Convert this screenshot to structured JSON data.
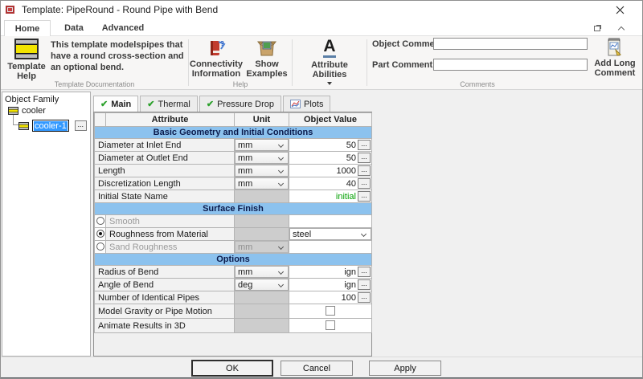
{
  "window": {
    "title": "Template: PipeRound - Round Pipe with Bend"
  },
  "ribbon_tabs": [
    {
      "label": "Home"
    },
    {
      "label": "Data"
    },
    {
      "label": "Advanced"
    }
  ],
  "groups": {
    "template_documentation": {
      "template_help_label": "Template Help",
      "description": "This template modelspipes that have a round cross-section and an optional bend.",
      "group_label": "Template Documentation"
    },
    "help": {
      "connectivity_label": "Connectivity Information",
      "show_examples_label": "Show Examples",
      "group_label": "Help"
    },
    "attribute_abilities": {
      "label": "Attribute Abilities",
      "icon_letter": "A"
    },
    "comments": {
      "object_comment_label": "Object Comment:",
      "object_comment_value": "",
      "part_comment_label": "Part Comment:",
      "part_comment_value": "",
      "add_long_comment_label": "Add Long Comment",
      "group_label": "Comments"
    }
  },
  "object_family": {
    "title": "Object Family",
    "root_item": "cooler",
    "child_item": "cooler-1",
    "ellipsis_label": "..."
  },
  "editor": {
    "tabs": [
      {
        "label": "Main",
        "icon": "check",
        "active": true
      },
      {
        "label": "Thermal",
        "icon": "check",
        "active": false
      },
      {
        "label": "Pressure Drop",
        "icon": "check",
        "active": false
      },
      {
        "label": "Plots",
        "icon": "chart",
        "active": false
      }
    ],
    "columns": [
      "Attribute",
      "Unit",
      "Object Value"
    ],
    "ellipsis_label": "...",
    "rows": [
      {
        "type": "section",
        "label": "Basic Geometry and Initial Conditions"
      },
      {
        "type": "data",
        "attribute": "Diameter at Inlet End",
        "unit": {
          "kind": "combo",
          "value": "mm"
        },
        "value": {
          "kind": "text",
          "text": "50",
          "ellipsis": true
        }
      },
      {
        "type": "data",
        "attribute": "Diameter at Outlet End",
        "unit": {
          "kind": "combo",
          "value": "mm"
        },
        "value": {
          "kind": "text",
          "text": "50",
          "ellipsis": true
        }
      },
      {
        "type": "data",
        "attribute": "Length",
        "unit": {
          "kind": "combo",
          "value": "mm"
        },
        "value": {
          "kind": "text",
          "text": "1000",
          "ellipsis": true
        }
      },
      {
        "type": "data",
        "attribute": "Discretization Length",
        "unit": {
          "kind": "combo",
          "value": "mm"
        },
        "value": {
          "kind": "text",
          "text": "40",
          "ellipsis": true
        }
      },
      {
        "type": "data",
        "attribute": "Initial State Name",
        "unit": {
          "kind": "blank"
        },
        "value": {
          "kind": "text",
          "text": "initial",
          "ellipsis": true,
          "green": true
        }
      },
      {
        "type": "section",
        "label": "Surface Finish"
      },
      {
        "type": "data",
        "radio": false,
        "disabled": true,
        "attribute": "Smooth",
        "unit": {
          "kind": "blank"
        },
        "value": {
          "kind": "blank"
        }
      },
      {
        "type": "data",
        "radio": true,
        "disabled": false,
        "attribute": "Roughness from Material",
        "unit": {
          "kind": "blank"
        },
        "value": {
          "kind": "combo",
          "text": "steel"
        }
      },
      {
        "type": "data",
        "radio": false,
        "disabled": true,
        "attribute": "Sand Roughness",
        "unit": {
          "kind": "combo",
          "value": "mm",
          "disabled": true
        },
        "value": {
          "kind": "blank"
        }
      },
      {
        "type": "section",
        "label": "Options"
      },
      {
        "type": "data",
        "attribute": "Radius of Bend",
        "unit": {
          "kind": "combo",
          "value": "mm"
        },
        "value": {
          "kind": "text",
          "text": "ign",
          "ellipsis": true
        }
      },
      {
        "type": "data",
        "attribute": "Angle of Bend",
        "unit": {
          "kind": "combo",
          "value": "deg"
        },
        "value": {
          "kind": "text",
          "text": "ign",
          "ellipsis": true
        }
      },
      {
        "type": "data",
        "attribute": "Number of Identical Pipes",
        "unit": {
          "kind": "blank"
        },
        "value": {
          "kind": "text",
          "text": "100",
          "ellipsis": true
        }
      },
      {
        "type": "data",
        "attribute": "Model Gravity or Pipe Motion",
        "unit": {
          "kind": "blank"
        },
        "value": {
          "kind": "checkbox",
          "checked": false
        }
      },
      {
        "type": "data",
        "attribute": "Animate Results in 3D",
        "unit": {
          "kind": "blank"
        },
        "value": {
          "kind": "checkbox",
          "checked": false
        }
      }
    ]
  },
  "footer": {
    "ok_label": "OK",
    "cancel_label": "Cancel",
    "apply_label": "Apply"
  },
  "colors": {
    "section_header_bg": "#8cc2ee",
    "initial_value_green": "#00a000",
    "selection_blue": "#3399ff",
    "check_green": "#2ca12c"
  }
}
